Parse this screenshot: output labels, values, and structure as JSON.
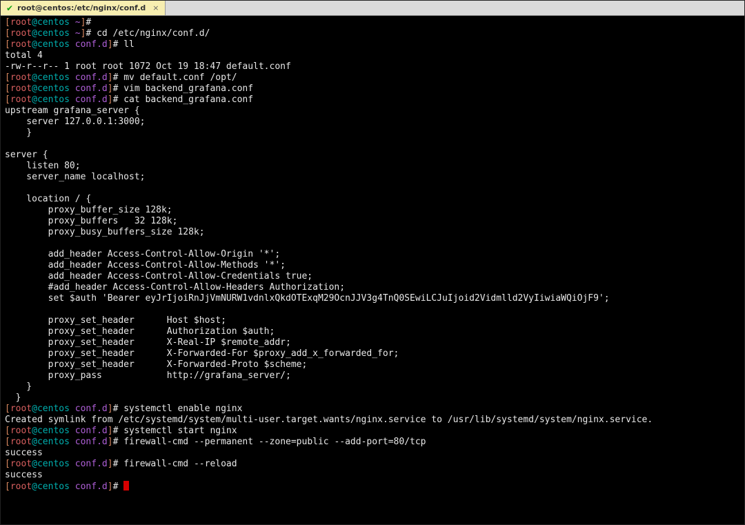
{
  "tab": {
    "title": "root@centos:/etc/nginx/conf.d",
    "close": "×"
  },
  "prompt": {
    "lb": "[",
    "rb": "]",
    "hash": "#",
    "user": "root",
    "at_host": "@centos ",
    "home": "~",
    "cwd": "conf.d"
  },
  "cmds": {
    "blank": "",
    "cd": " cd /etc/nginx/conf.d/",
    "ll": " ll",
    "mv": " mv default.conf /opt/",
    "vim": " vim backend_grafana.conf",
    "cat": " cat backend_grafana.conf",
    "enable": " systemctl enable nginx",
    "start": " systemctl start nginx",
    "fw_add": " firewall-cmd --permanent --zone=public --add-port=80/tcp",
    "fw_reload": " firewall-cmd --reload",
    "final": " "
  },
  "out": {
    "total": "total 4",
    "lsline": "-rw-r--r-- 1 root root 1072 Oct 19 18:47 default.conf",
    "symlink": "Created symlink from /etc/systemd/system/multi-user.target.wants/nginx.service to /usr/lib/systemd/system/nginx.service.",
    "success1": "success",
    "success2": "success"
  },
  "conf": {
    "l01": "upstream grafana_server {",
    "l02": "    server 127.0.0.1:3000;",
    "l03": "    }",
    "l04": "",
    "l05": "server {",
    "l06": "    listen 80;",
    "l07": "    server_name localhost;",
    "l08": "",
    "l09": "    location / {",
    "l10": "        proxy_buffer_size 128k;",
    "l11": "        proxy_buffers   32 128k;",
    "l12": "        proxy_busy_buffers_size 128k;",
    "l13": "",
    "l14": "        add_header Access-Control-Allow-Origin '*';",
    "l15": "        add_header Access-Control-Allow-Methods '*';",
    "l16": "        add_header Access-Control-Allow-Credentials true;",
    "l17": "        #add_header Access-Control-Allow-Headers Authorization;",
    "l18": "        set $auth 'Bearer eyJrIjoiRnJjVmNURW1vdnlxQkdOTExqM29OcnJJV3g4TnQ0SEwiLCJuIjoid2Vidmlld2VyIiwiaWQiOjF9';",
    "l19": "",
    "l20": "        proxy_set_header      Host $host;",
    "l21": "        proxy_set_header      Authorization $auth;",
    "l22": "        proxy_set_header      X-Real-IP $remote_addr;",
    "l23": "        proxy_set_header      X-Forwarded-For $proxy_add_x_forwarded_for;",
    "l24": "        proxy_set_header      X-Forwarded-Proto $scheme;",
    "l25": "        proxy_pass            http://grafana_server/;",
    "l26": "    }",
    "l27": "  }"
  }
}
